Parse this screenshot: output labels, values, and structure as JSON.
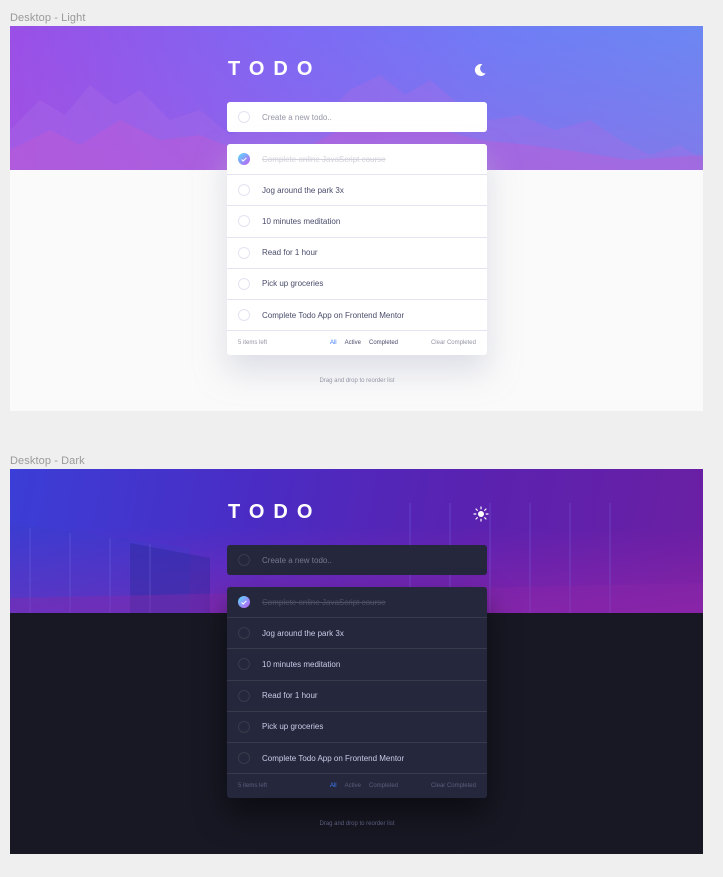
{
  "frames": {
    "light": {
      "label": "Desktop - Light"
    },
    "dark": {
      "label": "Desktop - Dark"
    }
  },
  "app": {
    "title": "TODO",
    "new_todo_placeholder": "Create a new todo..",
    "light_theme_toggle_icon": "moon-icon",
    "dark_theme_toggle_icon": "sun-icon"
  },
  "todos": [
    {
      "text": "Complete online JavaScript course",
      "completed": true
    },
    {
      "text": "Jog around the park 3x",
      "completed": false
    },
    {
      "text": "10 minutes meditation",
      "completed": false
    },
    {
      "text": "Read for 1 hour",
      "completed": false
    },
    {
      "text": "Pick up groceries",
      "completed": false
    },
    {
      "text": "Complete Todo App on Frontend Mentor",
      "completed": false
    }
  ],
  "footer": {
    "items_left": "5 items left",
    "filters": [
      "All",
      "Active",
      "Completed"
    ],
    "selected_filter": "All",
    "clear_label": "Clear Completed"
  },
  "hint": "Drag and drop to reorder list",
  "colors": {
    "bright_blue": "#3a7cfd",
    "check_gradient_start": "#57ddff",
    "check_gradient_end": "#c058f3",
    "light_page_bg": "#fafafa",
    "dark_page_bg": "#181824",
    "dark_card_bg": "#25273c"
  }
}
